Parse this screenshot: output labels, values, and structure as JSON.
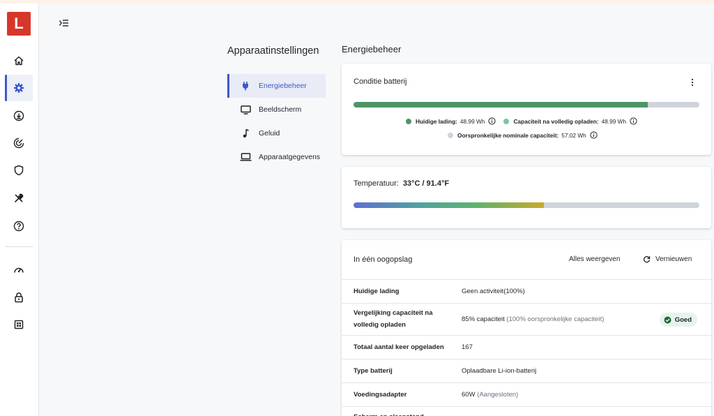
{
  "app": {
    "logo_letter": "L",
    "accent": "#3d58c9",
    "brand": "#d6372a"
  },
  "rail": {
    "items": [
      {
        "name": "home-icon",
        "active": false
      },
      {
        "name": "gear-icon",
        "active": true
      },
      {
        "name": "download-icon",
        "active": false
      },
      {
        "name": "radar-icon",
        "active": false
      },
      {
        "name": "shield-icon",
        "active": false
      },
      {
        "name": "tools-icon",
        "active": false
      },
      {
        "name": "help-icon",
        "active": false
      },
      {
        "name": "speedometer-icon",
        "active": false
      },
      {
        "name": "lock-icon",
        "active": false
      },
      {
        "name": "grid-icon",
        "active": false
      }
    ]
  },
  "settings_nav": {
    "title": "Apparaatinstellingen",
    "items": [
      {
        "label": "Energiebeheer",
        "icon": "plug-icon",
        "active": true
      },
      {
        "label": "Beeldscherm",
        "icon": "monitor-icon",
        "active": false
      },
      {
        "label": "Geluid",
        "icon": "music-note-icon",
        "active": false
      },
      {
        "label": "Apparaatgegevens",
        "icon": "laptop-icon",
        "active": false
      }
    ]
  },
  "main": {
    "title": "Energiebeheer",
    "battery": {
      "title": "Conditie batterij",
      "fill_fraction": 0.85,
      "legend": [
        {
          "label": "Huidige lading:",
          "value": "48.99 Wh",
          "color": "#4e9467"
        },
        {
          "label": "Capaciteit na volledig opladen:",
          "value": "48.99 Wh",
          "color": "#7cc59a"
        },
        {
          "label": "Oorspronkelijke nominale capaciteit:",
          "value": "57.02 Wh",
          "color": "#cfd4dc"
        }
      ]
    },
    "temperature": {
      "label": "Temperatuur:",
      "value": "33°C / 91.4°F",
      "fill_fraction": 0.55
    },
    "overview": {
      "title": "In één oogopslag",
      "show_all": "Alles weergeven",
      "refresh": "Vernieuwen",
      "rows": [
        {
          "key": "Huidige lading",
          "value": "Geen activiteit(100%)",
          "muted": ""
        },
        {
          "key": "Vergelijking capaciteit na volledig opladen",
          "value": "85% capaciteit",
          "muted": " (100% oorspronkelijke capaciteit)",
          "badge": "Goed"
        },
        {
          "key": "Totaal aantal keer opgeladen",
          "value": "167",
          "muted": ""
        },
        {
          "key": "Type batterij",
          "value": "Oplaadbare Li-ion-batterij",
          "muted": ""
        },
        {
          "key": "Voedingsadapter",
          "value": "60W",
          "muted": " (Aangesloten)"
        },
        {
          "key": "Scherm en slaapstand",
          "value": "",
          "muted": ""
        }
      ]
    }
  }
}
